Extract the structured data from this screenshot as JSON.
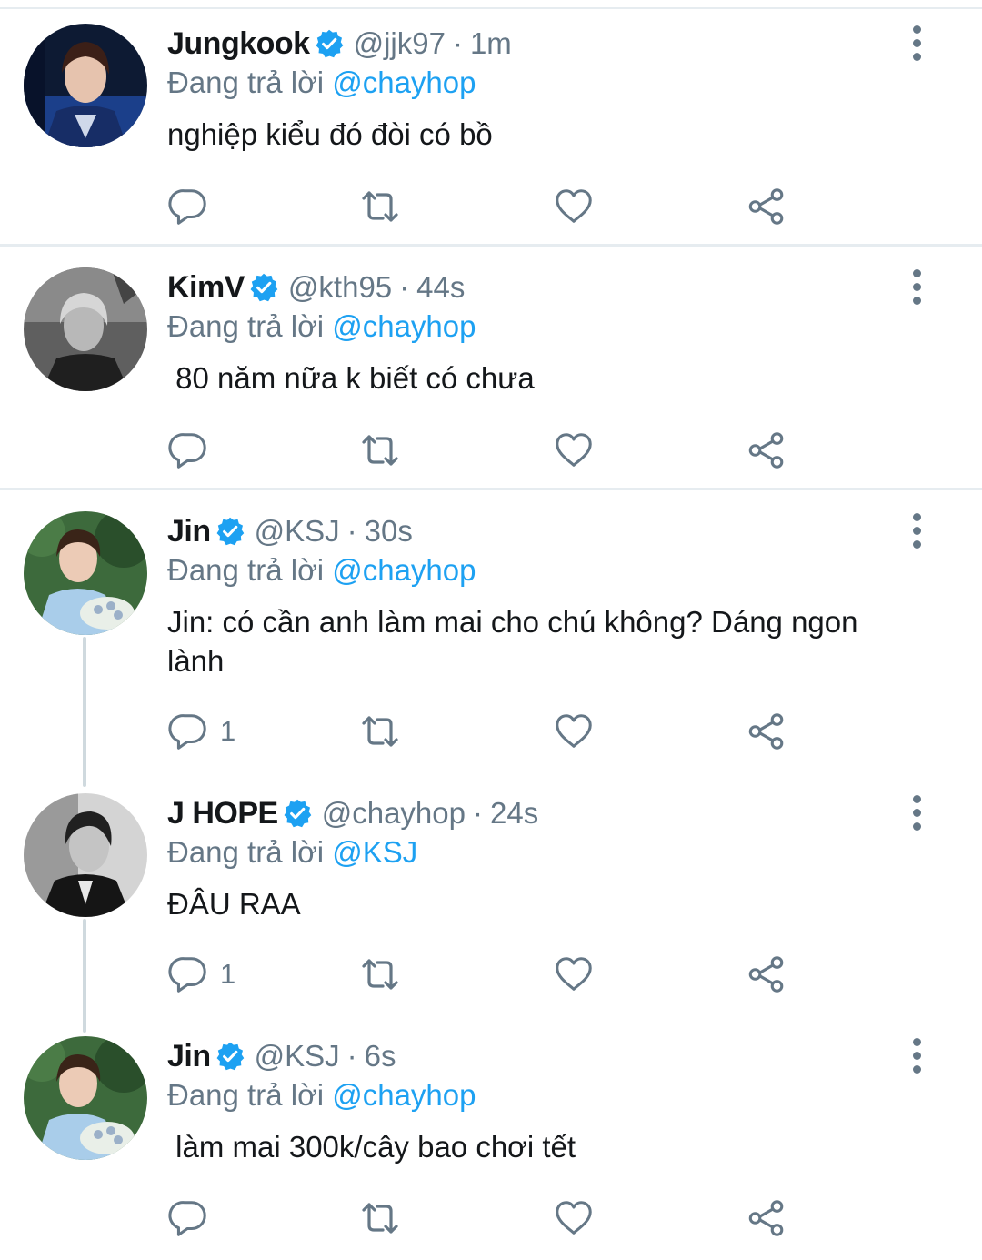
{
  "reply_label": "Đang trả lời",
  "colors": {
    "text": "#14171a",
    "secondary": "#657786",
    "accent": "#1da1f2",
    "divider": "#e6ecf0",
    "thread_line": "#cfd9de"
  },
  "icons": {
    "reply": "reply-icon",
    "retweet": "retweet-icon",
    "like": "heart-icon",
    "share": "share-icon",
    "verified": "verified-badge-icon",
    "more": "more-options-icon"
  },
  "tweets": [
    {
      "name": "Jungkook",
      "handle": "@jjk97",
      "time": "1m",
      "reply_to": "@chayhop",
      "text": "nghiệp kiểu đó đòi có bồ",
      "reply_count": ""
    },
    {
      "name": "KimV",
      "handle": "@kth95",
      "time": "44s",
      "reply_to": "@chayhop",
      "text": " 80 năm nữa k biết có chưa",
      "reply_count": ""
    },
    {
      "name": "Jin",
      "handle": "@KSJ",
      "time": "30s",
      "reply_to": "@chayhop",
      "text": "Jin: có cần anh làm mai cho chú không? Dáng ngon lành",
      "reply_count": "1"
    },
    {
      "name": "J HOPE",
      "handle": "@chayhop",
      "time": "24s",
      "reply_to": "@KSJ",
      "text": "ĐÂU RAA",
      "reply_count": "1"
    },
    {
      "name": "Jin",
      "handle": "@KSJ",
      "time": "6s",
      "reply_to": "@chayhop",
      "text": " làm mai 300k/cây bao chơi tết",
      "reply_count": ""
    }
  ]
}
